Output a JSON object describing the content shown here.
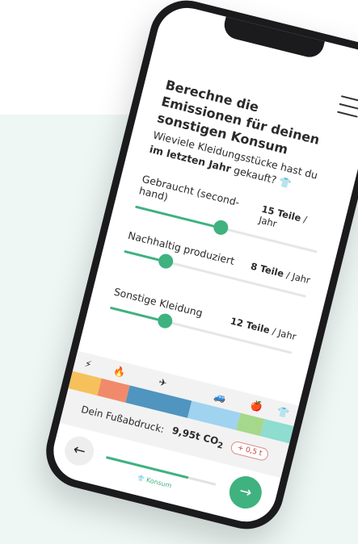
{
  "header": {
    "title": "Berechne die Emissionen für deinen sonstigen Konsum",
    "menu_icon": "hamburger-menu-icon"
  },
  "question": {
    "prefix": "Wieviele Kleidungsstücke hast du",
    "bold": "im letzten Jahr",
    "suffix": "gekauft?",
    "icon": "shirt-icon"
  },
  "sliders": [
    {
      "label": "Gebraucht (second-hand)",
      "value": "15 Teile",
      "unit": "/ Jahr",
      "level": 0.47
    },
    {
      "label": "Nachhaltig produziert",
      "value": "8 Teile",
      "unit": "/ Jahr",
      "level": 0.23
    },
    {
      "label": "Sonstige Kleidung",
      "value": "12 Teile",
      "unit": "/ Jahr",
      "level": 0.3
    }
  ],
  "footprint": {
    "label": "Dein Fußabdruck:",
    "value": "9,95t CO",
    "value_sub": "2",
    "delta": "+ 0,5 t",
    "segments": [
      {
        "icon": "⚡",
        "icon_name": "lightning-icon",
        "color": "#f6c15b",
        "share": 0.13
      },
      {
        "icon": "🔥",
        "icon_name": "fire-icon",
        "color": "#f08a6a",
        "share": 0.13
      },
      {
        "icon": "✈",
        "icon_name": "plane-icon",
        "color": "#4f95c0",
        "share": 0.28
      },
      {
        "icon": "🚙",
        "icon_name": "car-icon",
        "color": "#9fd3ef",
        "share": 0.22
      },
      {
        "icon": "🍎",
        "icon_name": "apple-icon",
        "color": "#a6d88c",
        "share": 0.11
      },
      {
        "icon": "👕",
        "icon_name": "shirt-icon",
        "color": "#8fdcd0",
        "share": 0.13
      }
    ]
  },
  "nav": {
    "back_label": "←",
    "next_label": "→",
    "progress_label": "Konsum",
    "progress": 0.75
  },
  "colors": {
    "accent": "#3fb27f",
    "background": "#eef7f4"
  }
}
